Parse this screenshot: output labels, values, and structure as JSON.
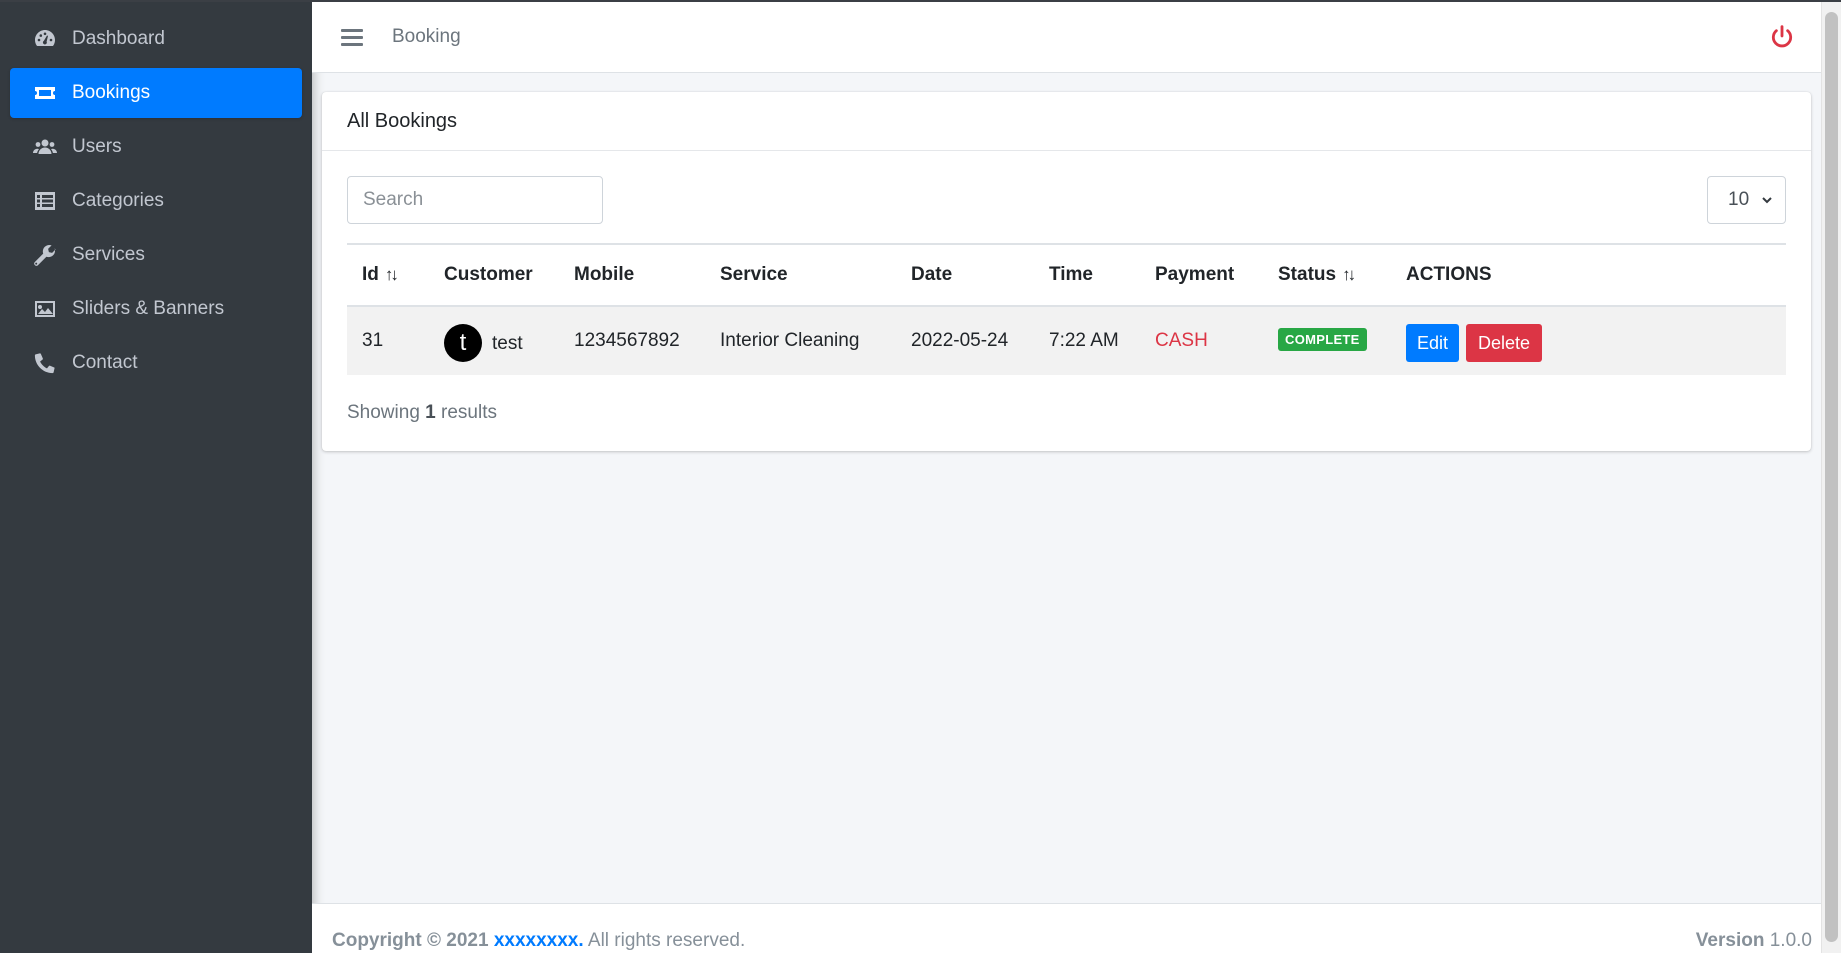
{
  "sidebar": {
    "items": [
      {
        "label": "Dashboard",
        "icon": "tachometer-icon",
        "active": false
      },
      {
        "label": "Bookings",
        "icon": "ticket-icon",
        "active": true
      },
      {
        "label": "Users",
        "icon": "users-icon",
        "active": false
      },
      {
        "label": "Categories",
        "icon": "list-icon",
        "active": false
      },
      {
        "label": "Services",
        "icon": "wrench-icon",
        "active": false
      },
      {
        "label": "Sliders & Banners",
        "icon": "image-icon",
        "active": false
      },
      {
        "label": "Contact",
        "icon": "phone-icon",
        "active": false
      }
    ]
  },
  "topbar": {
    "title": "Booking",
    "menu_icon": "hamburger-icon",
    "logout_icon": "power-icon"
  },
  "card": {
    "title": "All Bookings",
    "search_placeholder": "Search",
    "page_size": "10",
    "columns": [
      "Id",
      "Customer",
      "Mobile",
      "Service",
      "Date",
      "Time",
      "Payment",
      "Status",
      "ACTIONS"
    ],
    "sort_symbol": "↑↓",
    "rows": [
      {
        "id": "31",
        "avatar_letter": "t",
        "customer": "test",
        "mobile": "1234567892",
        "service": "Interior Cleaning",
        "date": "2022-05-24",
        "time": "7:22 AM",
        "payment": "CASH",
        "status": "COMPLETE",
        "edit_label": "Edit",
        "delete_label": "Delete"
      }
    ],
    "showing_prefix": "Showing",
    "showing_count": "1",
    "showing_suffix": "results"
  },
  "footer": {
    "copyright": "Copyright © 2021",
    "brand": "xxxxxxxx.",
    "rights": "All rights reserved.",
    "version_label": "Version",
    "version": "1.0.0"
  },
  "colors": {
    "sidebar_bg": "#343a40",
    "accent": "#007bff",
    "danger": "#dc3545",
    "success": "#28a745"
  }
}
